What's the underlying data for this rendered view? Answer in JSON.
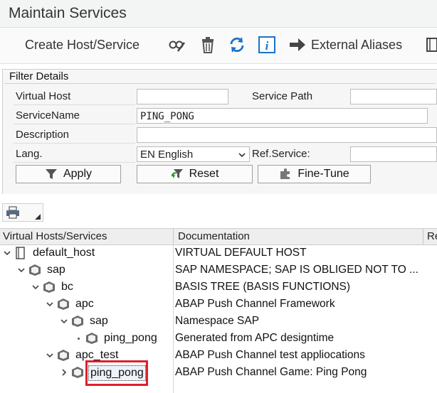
{
  "window": {
    "title": "Maintain Services"
  },
  "toolbar": {
    "create_label": "Create Host/Service",
    "external_aliases_label": "External Aliases",
    "icons": [
      "display-change-icon",
      "trash-icon",
      "refresh-icon",
      "info-icon",
      "arrow-right-icon",
      "more-icon"
    ]
  },
  "filter": {
    "legend": "Filter Details",
    "virtual_host_label": "Virtual Host",
    "virtual_host_value": "",
    "service_path_label": "Service Path",
    "service_path_value": "",
    "service_name_label": "ServiceName",
    "service_name_value": "PING_PONG",
    "description_label": "Description",
    "description_value": "",
    "lang_label": "Lang.",
    "lang_value": "EN English",
    "ref_service_label": "Ref.Service:",
    "ref_service_value": ""
  },
  "buttons": {
    "apply": "Apply",
    "reset": "Reset",
    "fine_tune": "Fine-Tune"
  },
  "tree": {
    "columns": [
      "Virtual Hosts/Services",
      "Documentation",
      "Re"
    ],
    "rows": [
      {
        "name": "default_host",
        "doc": "VIRTUAL DEFAULT HOST"
      },
      {
        "name": "sap",
        "doc": "SAP NAMESPACE; SAP IS OBLIGED NOT TO ..."
      },
      {
        "name": "bc",
        "doc": "BASIS TREE (BASIS FUNCTIONS)"
      },
      {
        "name": "apc",
        "doc": "ABAP Push Channel Framework"
      },
      {
        "name": "sap",
        "doc": "Namespace SAP"
      },
      {
        "name": "ping_pong",
        "doc": "Generated from APC designtime"
      },
      {
        "name": "apc_test",
        "doc": "ABAP Push Channel test appliocations"
      },
      {
        "name": "ping_pong",
        "doc": "ABAP  Push Channel Game: Ping Pong"
      }
    ]
  },
  "colors": {
    "highlight": "#e0202a",
    "accent": "#1a73c7",
    "toolbar_bg": "#fafafa"
  }
}
